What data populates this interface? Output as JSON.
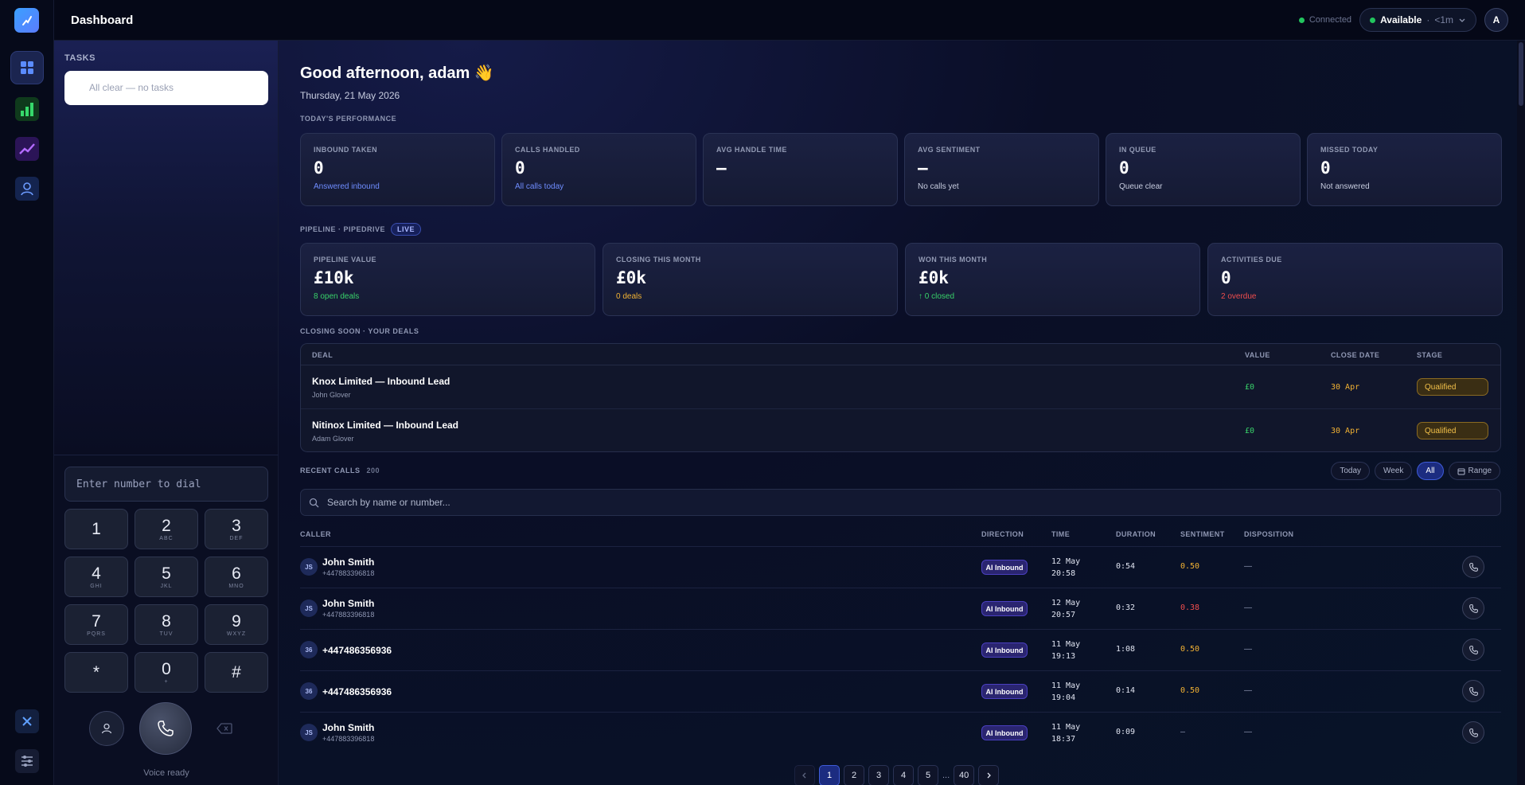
{
  "topbar": {
    "title": "Dashboard",
    "connection": "Connected",
    "status": "Available",
    "status_sep": " · ",
    "status_time": "<1m",
    "avatar": "A"
  },
  "tasks": {
    "heading": "TASKS",
    "empty": "All clear — no tasks"
  },
  "dialer": {
    "placeholder": "Enter number to dial",
    "keys": [
      {
        "digit": "1",
        "letters": ""
      },
      {
        "digit": "2",
        "letters": "ABC"
      },
      {
        "digit": "3",
        "letters": "DEF"
      },
      {
        "digit": "4",
        "letters": "GHI"
      },
      {
        "digit": "5",
        "letters": "JKL"
      },
      {
        "digit": "6",
        "letters": "MNO"
      },
      {
        "digit": "7",
        "letters": "PQRS"
      },
      {
        "digit": "8",
        "letters": "TUV"
      },
      {
        "digit": "9",
        "letters": "WXYZ"
      },
      {
        "digit": "*",
        "letters": ""
      },
      {
        "digit": "0",
        "letters": "+"
      },
      {
        "digit": "#",
        "letters": ""
      }
    ],
    "status": "Voice ready"
  },
  "greeting": {
    "title": "Good afternoon, adam",
    "emoji": "👋",
    "date": "Thursday, 21 May 2026"
  },
  "performance": {
    "heading": "TODAY'S PERFORMANCE",
    "cards": [
      {
        "label": "INBOUND TAKEN",
        "value": "0",
        "sub": "Answered inbound",
        "sub_color": "#6f8dff"
      },
      {
        "label": "CALLS HANDLED",
        "value": "0",
        "sub": "All calls today",
        "sub_color": "#6f8dff"
      },
      {
        "label": "AVG HANDLE TIME",
        "value": "—",
        "sub": "",
        "sub_color": "#c8cde0"
      },
      {
        "label": "AVG SENTIMENT",
        "value": "—",
        "sub": "No calls yet",
        "sub_color": "#c8cde0"
      },
      {
        "label": "IN QUEUE",
        "value": "0",
        "sub": "Queue clear",
        "sub_color": "#c8cde0"
      },
      {
        "label": "MISSED TODAY",
        "value": "0",
        "sub": "Not answered",
        "sub_color": "#c8cde0"
      }
    ]
  },
  "pipeline": {
    "heading": "PIPELINE · PIPEDRIVE",
    "badge": "LIVE",
    "cards": [
      {
        "label": "PIPELINE VALUE",
        "value": "£10k",
        "sub": "8 open deals",
        "sub_color": "#38d26a"
      },
      {
        "label": "CLOSING THIS MONTH",
        "value": "£0k",
        "sub": "0 deals",
        "sub_color": "#f2b233"
      },
      {
        "label": "WON THIS MONTH",
        "value": "£0k",
        "sub": "↑ 0 closed",
        "sub_color": "#38d26a"
      },
      {
        "label": "ACTIVITIES DUE",
        "value": "0",
        "sub": "2 overdue",
        "sub_color": "#ef4d4d"
      }
    ]
  },
  "deals": {
    "heading": "CLOSING SOON · YOUR DEALS",
    "columns": {
      "deal": "DEAL",
      "value": "VALUE",
      "close_date": "CLOSE DATE",
      "stage": "STAGE"
    },
    "rows": [
      {
        "name": "Knox Limited — Inbound Lead",
        "owner": "John Glover",
        "value": "£0",
        "close_date": "30 Apr",
        "stage": "Qualified"
      },
      {
        "name": "Nitinox Limited — Inbound Lead",
        "owner": "Adam Glover",
        "value": "£0",
        "close_date": "30 Apr",
        "stage": "Qualified"
      }
    ]
  },
  "recent_calls": {
    "heading": "RECENT CALLS",
    "count": "200",
    "filters": [
      {
        "label": "Today",
        "active": false
      },
      {
        "label": "Week",
        "active": false
      },
      {
        "label": "All",
        "active": true
      },
      {
        "label": "Range",
        "active": false
      }
    ],
    "search_placeholder": "Search by name or number...",
    "columns": {
      "caller": "CALLER",
      "direction": "DIRECTION",
      "time": "TIME",
      "duration": "DURATION",
      "sentiment": "SENTIMENT",
      "disposition": "DISPOSITION"
    },
    "rows": [
      {
        "initials": "JS",
        "name": "John Smith",
        "number": "+447883396818",
        "direction": "AI Inbound",
        "date": "12 May",
        "time": "20:58",
        "duration": "0:54",
        "sentiment": "0.50",
        "sentiment_color": "#f2b233",
        "disposition": "—"
      },
      {
        "initials": "JS",
        "name": "John Smith",
        "number": "+447883396818",
        "direction": "AI Inbound",
        "date": "12 May",
        "time": "20:57",
        "duration": "0:32",
        "sentiment": "0.38",
        "sentiment_color": "#ef4d4d",
        "disposition": "—"
      },
      {
        "initials": "36",
        "name": "+447486356936",
        "number": "",
        "direction": "AI Inbound",
        "date": "11 May",
        "time": "19:13",
        "duration": "1:08",
        "sentiment": "0.50",
        "sentiment_color": "#f2b233",
        "disposition": "—"
      },
      {
        "initials": "36",
        "name": "+447486356936",
        "number": "",
        "direction": "AI Inbound",
        "date": "11 May",
        "time": "19:04",
        "duration": "0:14",
        "sentiment": "0.50",
        "sentiment_color": "#f2b233",
        "disposition": "—"
      },
      {
        "initials": "JS",
        "name": "John Smith",
        "number": "+447883396818",
        "direction": "AI Inbound",
        "date": "11 May",
        "time": "18:37",
        "duration": "0:09",
        "sentiment": "—",
        "sentiment_color": "#8f97b3",
        "disposition": "—"
      }
    ],
    "pages": [
      "1",
      "2",
      "3",
      "4",
      "5"
    ],
    "current_page": "1",
    "ellipsis": "...",
    "last_page": "40"
  },
  "colors": {
    "accent": "#3f5cd9",
    "positive": "#38d26a",
    "warning": "#f2b233",
    "negative": "#ef4d4d"
  },
  "icons": {
    "rail": [
      "dashboard-icon",
      "bar-chart-icon",
      "trend-icon",
      "user-icon"
    ],
    "rail_bottom": [
      "brand-mark-icon",
      "sliders-icon"
    ]
  }
}
